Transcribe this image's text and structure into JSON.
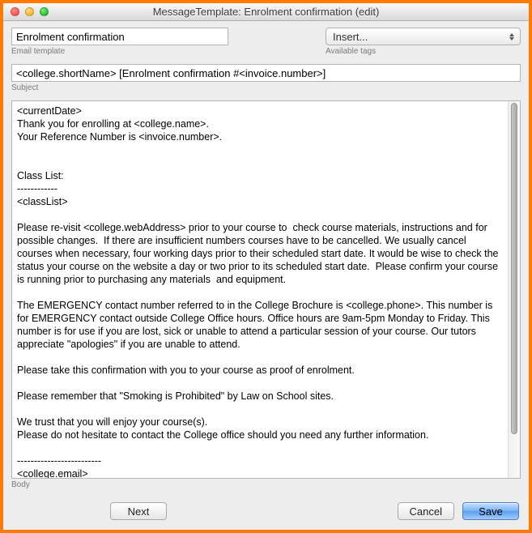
{
  "window": {
    "title": "MessageTemplate: Enrolment confirmation (edit)"
  },
  "template": {
    "name_value": "Enrolment confirmation",
    "name_caption": "Email template",
    "insert_value": "Insert...",
    "insert_caption": "Available tags"
  },
  "subject": {
    "value": "<college.shortName> [Enrolment confirmation #<invoice.number>]",
    "caption": "Subject"
  },
  "body": {
    "value": "<currentDate>\nThank you for enrolling at <college.name>.\nYour Reference Number is <invoice.number>.\n\n\nClass List:\n------------\n<classList>\n\nPlease re-visit <college.webAddress> prior to your course to  check course materials, instructions and for possible changes.  If there are insufficient numbers courses have to be cancelled. We usually cancel courses when necessary, four working days prior to their scheduled start date. It would be wise to check the status your course on the website a day or two prior to its scheduled start date.  Please confirm your course is running prior to purchasing any materials  and equipment.\n\nThe EMERGENCY contact number referred to in the College Brochure is <college.phone>. This number is for EMERGENCY contact outside College Office hours. Office hours are 9am-5pm Monday to Friday. This number is for use if you are lost, sick or unable to attend a particular session of your course. Our tutors appreciate \"apologies\" if you are unable to attend.\n\nPlease take this confirmation with you to your course as proof of enrolment.\n\nPlease remember that \"Smoking is Prohibited\" by Law on School sites.\n\nWe trust that you will enjoy your course(s).\nPlease do not hesitate to contact the College office should you need any further information.\n\n-------------------------\n<college.email>\n<college.phone> phone\n<college.fax> fax",
    "caption": "Body"
  },
  "buttons": {
    "next": "Next",
    "cancel": "Cancel",
    "save": "Save"
  }
}
